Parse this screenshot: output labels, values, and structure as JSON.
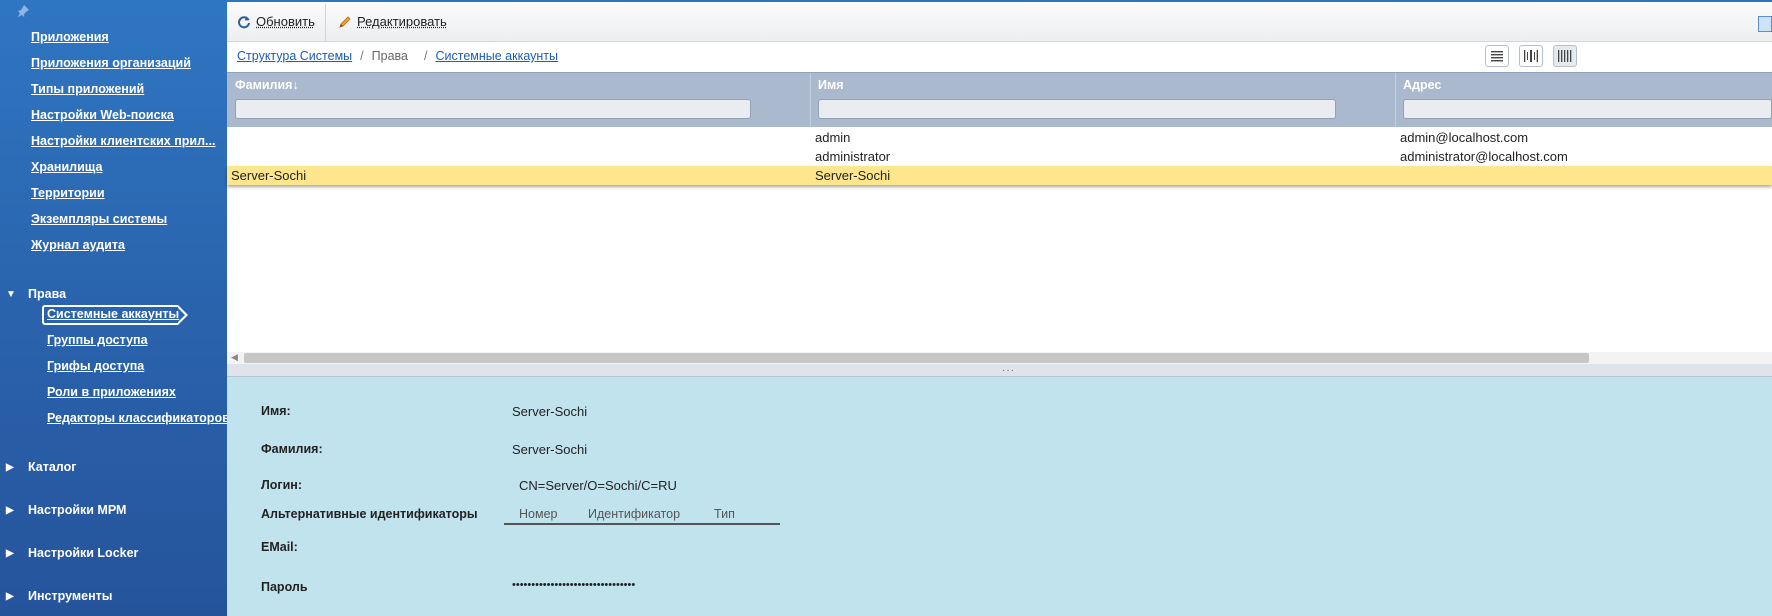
{
  "sidebar": {
    "items": [
      {
        "label": "Приложения"
      },
      {
        "label": "Приложения организаций"
      },
      {
        "label": "Типы приложений"
      },
      {
        "label": "Настройки Web-поиска"
      },
      {
        "label": "Настройки клиентских прил..."
      },
      {
        "label": "Хранилища"
      },
      {
        "label": "Территории"
      },
      {
        "label": "Экземпляры системы"
      },
      {
        "label": "Журнал аудита"
      }
    ],
    "rights_section": "Права",
    "rights_items": [
      {
        "label": "Системные аккаунты"
      },
      {
        "label": "Группы доступа"
      },
      {
        "label": "Грифы доступа"
      },
      {
        "label": "Роли в приложениях"
      },
      {
        "label": "Редакторы классификаторов"
      }
    ],
    "sections": [
      {
        "label": "Каталог"
      },
      {
        "label": "Настройки МРМ"
      },
      {
        "label": "Настройки Locker"
      },
      {
        "label": "Инструменты"
      }
    ]
  },
  "toolbar": {
    "refresh_label": "Обновить",
    "edit_label": "Редактировать"
  },
  "breadcrumb": {
    "root": "Структура Системы",
    "middle": "Права",
    "current": "Системные аккаунты",
    "separator": "/"
  },
  "grid": {
    "columns": [
      {
        "title": "Фамилия↓"
      },
      {
        "title": "Имя"
      },
      {
        "title": "Адрес"
      }
    ],
    "rows": [
      {
        "surname": "",
        "name": "admin",
        "address": "admin@localhost.com"
      },
      {
        "surname": "",
        "name": "administrator",
        "address": "administrator@localhost.com"
      },
      {
        "surname": "Server-Sochi",
        "name": "Server-Sochi",
        "address": ""
      }
    ],
    "selected_row_index": 2
  },
  "detail": {
    "name_label": "Имя:",
    "name_value": "Server-Sochi",
    "surname_label": "Фамилия:",
    "surname_value": "Server-Sochi",
    "login_label": "Логин:",
    "login_value": "CN=Server/O=Sochi/C=RU",
    "alt_ids_label": "Альтернативные идентификаторы",
    "alt_ids_columns": [
      "Номер",
      "Идентификатор",
      "Тип"
    ],
    "email_label": "EMail:",
    "email_value": "",
    "password_label": "Пароль",
    "password_value": "••••••••••••••••••••••••••••••••"
  },
  "colors": {
    "sidebar": "#2a63ad",
    "grid_header": "#aab9cd",
    "selected_row": "#fde68c",
    "detail_bg": "#c1e3ee",
    "link": "#1a5fb4"
  }
}
